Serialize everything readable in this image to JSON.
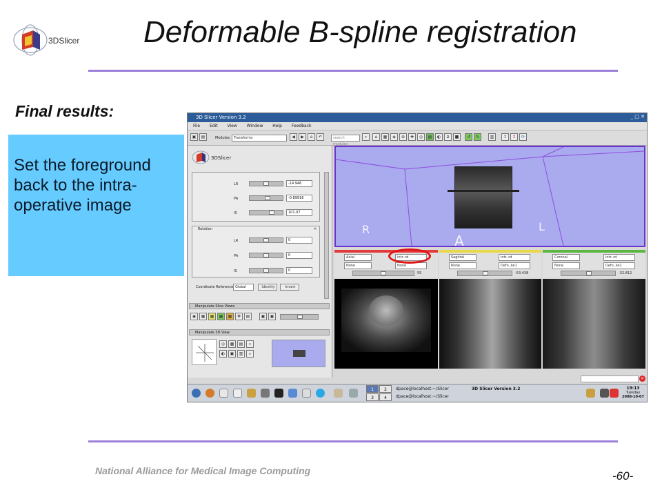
{
  "slide": {
    "title": "Deformable B-spline registration",
    "logo_text": "3DSlicer",
    "subtitle": "Final results:",
    "note": "Set the foreground back to the intra-operative image",
    "footer": "National Alliance for Medical Image Computing",
    "page_number": "-60-",
    "rule_color": "#9b7fd9",
    "note_color": "#66ccff"
  },
  "app": {
    "title": "3D Slicer Version 3.2",
    "menu": [
      "File",
      "Edit",
      "View",
      "Window",
      "Help",
      "Feedback"
    ],
    "modules_label": "Modules:",
    "module_selected": "Transforms",
    "search_placeholder": "search modules",
    "logo_text": "3DSlicer",
    "translation": {
      "lr_label": "LR",
      "lr_value": "-14.946",
      "pa_label": "PA",
      "pa_value": "-0.89916",
      "is_label": "IS",
      "is_value": "101.07"
    },
    "rotation": {
      "title": "Rotation",
      "lr_label": "LR",
      "lr_value": "0",
      "pa_label": "PA",
      "pa_value": "0",
      "is_label": "IS",
      "is_value": "0"
    },
    "coord_label": "Coordinate Reference:",
    "coord_value": "Global",
    "identity_label": "Identity",
    "invert_label": "Invert",
    "manip_slice_label": "Manipulate Slice Views",
    "manip_3d_label": "Manipulate 3D View",
    "view3d": {
      "left": "R",
      "right": "L",
      "bottom": "A"
    },
    "slices": [
      {
        "orientation": "Axial",
        "foreground": "intr..rd",
        "background": "None",
        "label": "None",
        "value": "55",
        "color": "#e33b3b"
      },
      {
        "orientation": "Sagittal",
        "foreground": "intr..rd",
        "background": "None",
        "label": "Defo..ke1",
        "value": "-53.438",
        "color": "#e8d84a"
      },
      {
        "orientation": "Coronal",
        "foreground": "intr..rd",
        "background": "None",
        "label": "Defo..ke1",
        "value": "-32.812",
        "color": "#5eb544"
      }
    ],
    "taskbar": {
      "desktops": [
        "1",
        "2",
        "3",
        "4"
      ],
      "item1": "dpace@localhost:~/Slicer",
      "item2": "dpace@localhost:~/Slicer",
      "item3": "3D Slicer Version 3.2",
      "time": "19:13",
      "day": "Tuesday",
      "date": "2008-10-07"
    }
  }
}
